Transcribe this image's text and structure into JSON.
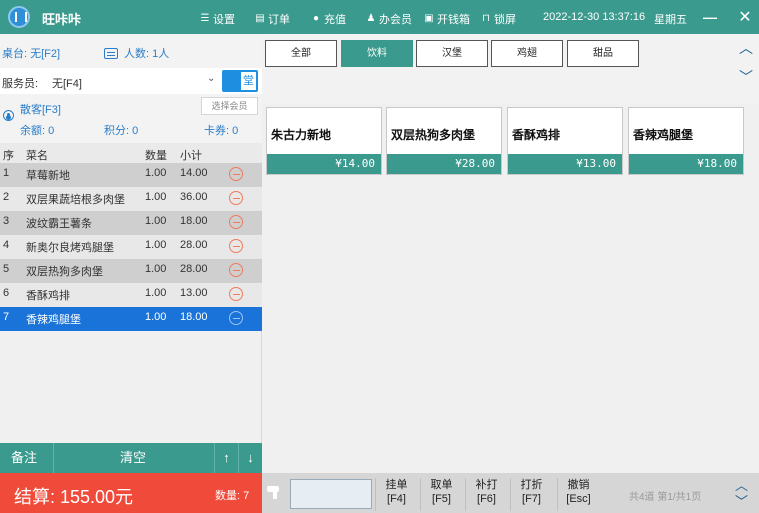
{
  "titlebar": {
    "app_name": "旺咔咔",
    "menu": [
      {
        "icon": "menu-icon",
        "label": "设置"
      },
      {
        "icon": "order-icon",
        "label": "订单"
      },
      {
        "icon": "recharge-icon",
        "label": "充值"
      },
      {
        "icon": "user-icon",
        "label": "办会员"
      },
      {
        "icon": "cashbox-icon",
        "label": "开钱箱"
      },
      {
        "icon": "lock-icon",
        "label": "锁屏"
      }
    ],
    "datetime": "2022-12-30 13:37:16",
    "weekday": "星期五",
    "minimize": "—",
    "close": "✕",
    "color": "#3a9a8d"
  },
  "order_panel": {
    "desk": "桌台: 无[F2]",
    "guests": "人数: 1人",
    "staff_label": "服务员:",
    "staff_value": "无[F4]",
    "dine_toggle": "堂",
    "member_name": "散客[F3]",
    "choose_member": "选择会员",
    "balance": "余额: 0",
    "points": "积分: 0",
    "coupon": "卡券: 0",
    "headers": {
      "idx": "序",
      "name": "菜名",
      "qty": "数量",
      "subtotal": "小计"
    },
    "items": [
      {
        "idx": "1",
        "name": "草莓新地",
        "qty": "1.00",
        "subtotal": "14.00"
      },
      {
        "idx": "2",
        "name": "双层果蔬培根多肉堡",
        "qty": "1.00",
        "subtotal": "36.00"
      },
      {
        "idx": "3",
        "name": "波纹霸王薯条",
        "qty": "1.00",
        "subtotal": "18.00"
      },
      {
        "idx": "4",
        "name": "新奥尔良烤鸡腿堡",
        "qty": "1.00",
        "subtotal": "28.00"
      },
      {
        "idx": "5",
        "name": "双层热狗多肉堡",
        "qty": "1.00",
        "subtotal": "28.00"
      },
      {
        "idx": "6",
        "name": "香酥鸡排",
        "qty": "1.00",
        "subtotal": "13.00"
      },
      {
        "idx": "7",
        "name": "香辣鸡腿堡",
        "qty": "1.00",
        "subtotal": "18.00"
      }
    ],
    "selected_index": 6,
    "notes": "备注",
    "clear": "清空",
    "up": "↑",
    "down": "↓",
    "checkout": "结算: 155.00元",
    "quantity": "数量: 7",
    "checkout_color": "#f04a3a"
  },
  "categories": {
    "tabs": [
      "全部",
      "饮料",
      "汉堡",
      "鸡翅",
      "甜品"
    ],
    "active_index": 1
  },
  "products": [
    {
      "name": "朱古力新地",
      "price": "¥14.00"
    },
    {
      "name": "双层热狗多肉堡",
      "price": "¥28.00"
    },
    {
      "name": "香酥鸡排",
      "price": "¥13.00"
    },
    {
      "name": "香辣鸡腿堡",
      "price": "¥18.00"
    }
  ],
  "bottom": {
    "actions": [
      {
        "label": "挂单",
        "key": "[F4]"
      },
      {
        "label": "取单",
        "key": "[F5]"
      },
      {
        "label": "补打",
        "key": "[F6]"
      },
      {
        "label": "打折",
        "key": "[F7]"
      },
      {
        "label": "撤销",
        "key": "[Esc]"
      }
    ],
    "pager": "共4道 第1/共1页"
  }
}
